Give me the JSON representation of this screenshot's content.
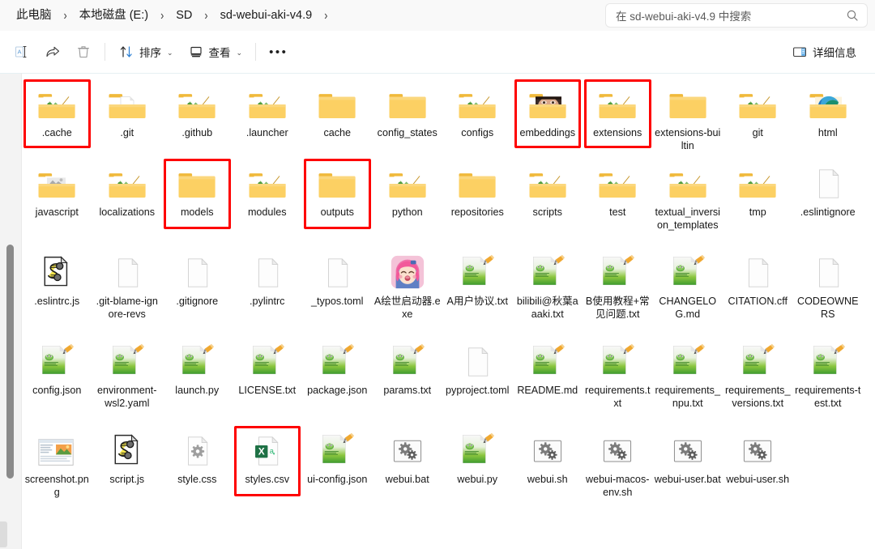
{
  "window": {
    "type": "file-explorer",
    "accent": "#0f6cbd",
    "highlight_color": "#fe0000",
    "folder_color": "#f7c55c"
  },
  "address": {
    "breadcrumbs": [
      "此电脑",
      "本地磁盘 (E:)",
      "SD",
      "sd-webui-aki-v4.9"
    ],
    "separator": "›",
    "trailing_separator": "›"
  },
  "search": {
    "placeholder": "在 sd-webui-aki-v4.9 中搜索",
    "icon": "search-icon"
  },
  "toolbar": {
    "rename_icon": "rename-icon",
    "share_icon": "share-icon",
    "delete_icon": "trash-icon",
    "sort_label": "排序",
    "sort_icon": "sort-arrows-icon",
    "view_label": "查看",
    "view_icon": "view-monitor-icon",
    "more_label": "•••",
    "details_label": "详细信息",
    "details_icon": "details-pane-icon",
    "chevron": "⌄"
  },
  "files": [
    {
      "name": ".cache",
      "icon": "folder-preview",
      "row": 0,
      "highlighted": true
    },
    {
      "name": ".git",
      "icon": "folder-doc",
      "row": 0,
      "highlighted": false
    },
    {
      "name": ".github",
      "icon": "folder-preview",
      "row": 0,
      "highlighted": false
    },
    {
      "name": ".launcher",
      "icon": "folder-preview",
      "row": 0,
      "highlighted": false
    },
    {
      "name": "cache",
      "icon": "folder-plain",
      "row": 0,
      "highlighted": false
    },
    {
      "name": "config_states",
      "icon": "folder-plain",
      "row": 0,
      "highlighted": false
    },
    {
      "name": "configs",
      "icon": "folder-preview",
      "row": 0,
      "highlighted": false
    },
    {
      "name": "embeddings",
      "icon": "folder-photo",
      "row": 0,
      "highlighted": true
    },
    {
      "name": "extensions",
      "icon": "folder-preview",
      "row": 0,
      "highlighted": true
    },
    {
      "name": "extensions-builtin",
      "icon": "folder-plain",
      "row": 0,
      "highlighted": false
    },
    {
      "name": "git",
      "icon": "folder-preview",
      "row": 0,
      "highlighted": false
    },
    {
      "name": "html",
      "icon": "folder-edge",
      "row": 0,
      "highlighted": false
    },
    {
      "name": "javascript",
      "icon": "folder-preview-gray",
      "row": 1,
      "highlighted": false
    },
    {
      "name": "localizations",
      "icon": "folder-preview",
      "row": 1,
      "highlighted": false
    },
    {
      "name": "models",
      "icon": "folder-plain",
      "row": 1,
      "highlighted": true
    },
    {
      "name": "modules",
      "icon": "folder-preview",
      "row": 1,
      "highlighted": false
    },
    {
      "name": "outputs",
      "icon": "folder-plain",
      "row": 1,
      "highlighted": true
    },
    {
      "name": "python",
      "icon": "folder-preview",
      "row": 1,
      "highlighted": false
    },
    {
      "name": "repositories",
      "icon": "folder-plain",
      "row": 1,
      "highlighted": false
    },
    {
      "name": "scripts",
      "icon": "folder-preview",
      "row": 1,
      "highlighted": false
    },
    {
      "name": "test",
      "icon": "folder-preview",
      "row": 1,
      "highlighted": false
    },
    {
      "name": "textual_inversion_templates",
      "icon": "folder-preview",
      "row": 1,
      "highlighted": false
    },
    {
      "name": "tmp",
      "icon": "folder-preview",
      "row": 1,
      "highlighted": false
    },
    {
      "name": ".eslintignore",
      "icon": "file-blank",
      "row": 1,
      "highlighted": false
    },
    {
      "name": ".eslintrc.js",
      "icon": "file-js",
      "row": 2,
      "highlighted": false
    },
    {
      "name": ".git-blame-ignore-revs",
      "icon": "file-blank",
      "row": 2,
      "highlighted": false
    },
    {
      "name": ".gitignore",
      "icon": "file-blank",
      "row": 2,
      "highlighted": false
    },
    {
      "name": ".pylintrc",
      "icon": "file-blank",
      "row": 2,
      "highlighted": false
    },
    {
      "name": "_typos.toml",
      "icon": "file-blank",
      "row": 2,
      "highlighted": false
    },
    {
      "name": "A绘世启动器.exe",
      "icon": "file-anime-exe",
      "row": 2,
      "highlighted": false
    },
    {
      "name": "A用户协议.txt",
      "icon": "file-notepad",
      "row": 2,
      "highlighted": false
    },
    {
      "name": "bilibili@秋葉aaaki.txt",
      "icon": "file-notepad",
      "row": 2,
      "highlighted": false
    },
    {
      "name": "B使用教程+常见问题.txt",
      "icon": "file-notepad",
      "row": 2,
      "highlighted": false
    },
    {
      "name": "CHANGELOG.md",
      "icon": "file-notepad",
      "row": 2,
      "highlighted": false
    },
    {
      "name": "CITATION.cff",
      "icon": "file-blank",
      "row": 2,
      "highlighted": false
    },
    {
      "name": "CODEOWNERS",
      "icon": "file-blank",
      "row": 2,
      "highlighted": false
    },
    {
      "name": "config.json",
      "icon": "file-notepad",
      "row": 3,
      "highlighted": false
    },
    {
      "name": "environment-wsl2.yaml",
      "icon": "file-notepad",
      "row": 3,
      "highlighted": false
    },
    {
      "name": "launch.py",
      "icon": "file-notepad",
      "row": 3,
      "highlighted": false
    },
    {
      "name": "LICENSE.txt",
      "icon": "file-notepad",
      "row": 3,
      "highlighted": false
    },
    {
      "name": "package.json",
      "icon": "file-notepad",
      "row": 3,
      "highlighted": false
    },
    {
      "name": "params.txt",
      "icon": "file-notepad",
      "row": 3,
      "highlighted": false
    },
    {
      "name": "pyproject.toml",
      "icon": "file-blank",
      "row": 3,
      "highlighted": false
    },
    {
      "name": "README.md",
      "icon": "file-notepad",
      "row": 3,
      "highlighted": false
    },
    {
      "name": "requirements.txt",
      "icon": "file-notepad",
      "row": 3,
      "highlighted": false
    },
    {
      "name": "requirements_npu.txt",
      "icon": "file-notepad",
      "row": 3,
      "highlighted": false
    },
    {
      "name": "requirements_versions.txt",
      "icon": "file-notepad",
      "row": 3,
      "highlighted": false
    },
    {
      "name": "requirements-test.txt",
      "icon": "file-notepad",
      "row": 3,
      "highlighted": false
    },
    {
      "name": "screenshot.png",
      "icon": "file-image",
      "row": 4,
      "highlighted": false
    },
    {
      "name": "script.js",
      "icon": "file-js",
      "row": 4,
      "highlighted": false
    },
    {
      "name": "style.css",
      "icon": "file-gear-doc",
      "row": 4,
      "highlighted": false
    },
    {
      "name": "styles.csv",
      "icon": "file-excel",
      "row": 4,
      "highlighted": true
    },
    {
      "name": "ui-config.json",
      "icon": "file-notepad",
      "row": 4,
      "highlighted": false
    },
    {
      "name": "webui.bat",
      "icon": "file-gears",
      "row": 4,
      "highlighted": false
    },
    {
      "name": "webui.py",
      "icon": "file-notepad",
      "row": 4,
      "highlighted": false
    },
    {
      "name": "webui.sh",
      "icon": "file-gears",
      "row": 4,
      "highlighted": false
    },
    {
      "name": "webui-macos-env.sh",
      "icon": "file-gears",
      "row": 4,
      "highlighted": false
    },
    {
      "name": "webui-user.bat",
      "icon": "file-gears",
      "row": 4,
      "highlighted": false
    },
    {
      "name": "webui-user.sh",
      "icon": "file-gears",
      "row": 4,
      "highlighted": false
    }
  ]
}
